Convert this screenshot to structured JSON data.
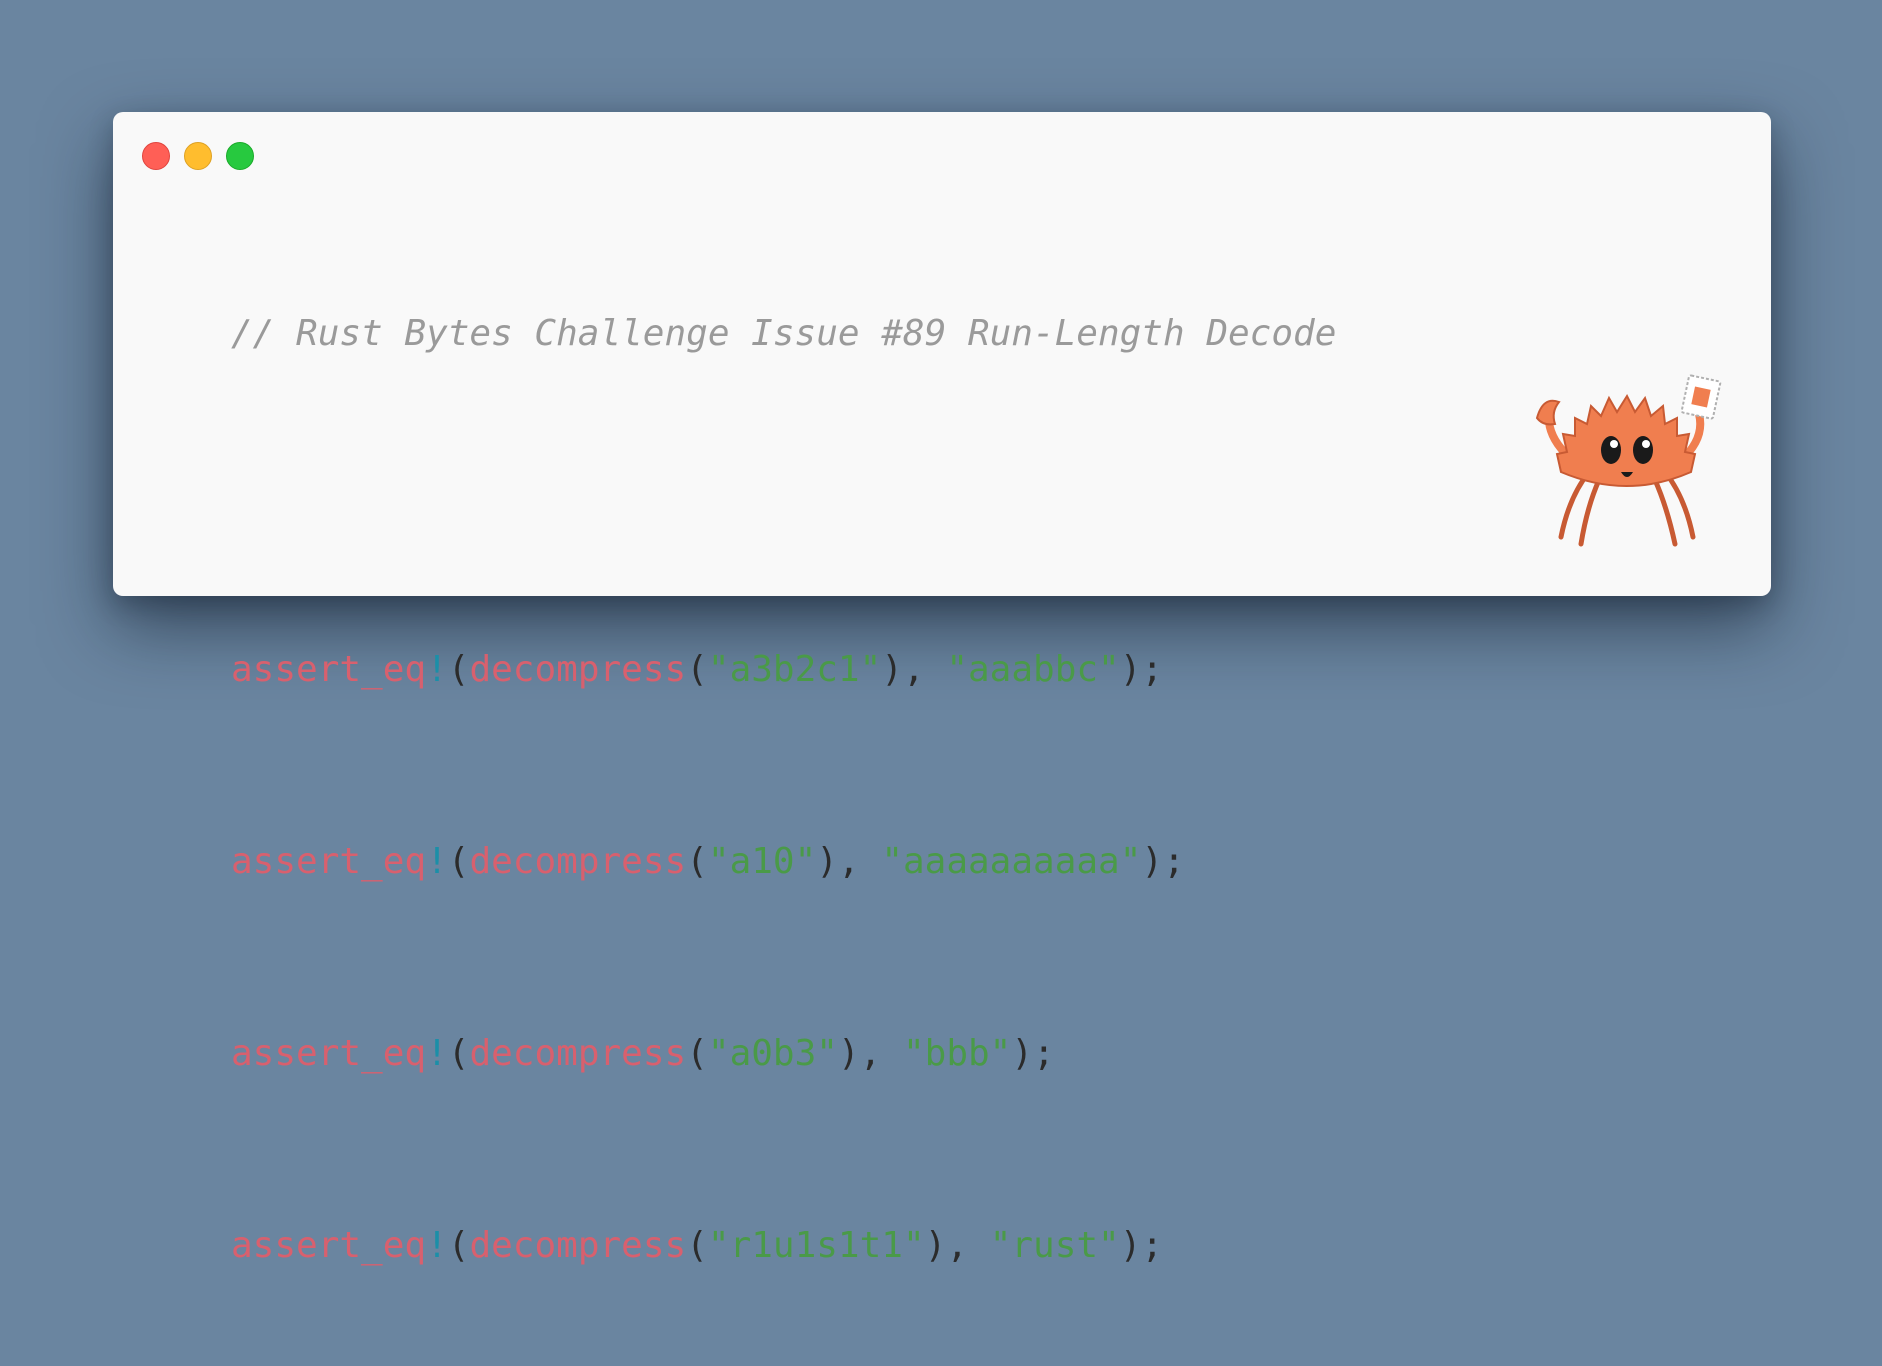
{
  "window": {
    "controls": {
      "close_color": "#ff5f56",
      "minimize_color": "#ffbd2e",
      "maximize_color": "#27c93f"
    }
  },
  "code": {
    "comment": "// Rust Bytes Challenge Issue #89 Run-Length Decode",
    "lines": [
      {
        "macro": "assert_eq",
        "bang": "!",
        "open": "(",
        "fn": "decompress",
        "fn_open": "(",
        "arg": "\"a3b2c1\"",
        "fn_close": ")",
        "sep": ", ",
        "expected": "\"aaabbc\"",
        "close": ");"
      },
      {
        "macro": "assert_eq",
        "bang": "!",
        "open": "(",
        "fn": "decompress",
        "fn_open": "(",
        "arg": "\"a10\"",
        "fn_close": ")",
        "sep": ", ",
        "expected": "\"aaaaaaaaaa\"",
        "close": ");"
      },
      {
        "macro": "assert_eq",
        "bang": "!",
        "open": "(",
        "fn": "decompress",
        "fn_open": "(",
        "arg": "\"a0b3\"",
        "fn_close": ")",
        "sep": ", ",
        "expected": "\"bbb\"",
        "close": ");"
      },
      {
        "macro": "assert_eq",
        "bang": "!",
        "open": "(",
        "fn": "decompress",
        "fn_open": "(",
        "arg": "\"r1u1s1t1\"",
        "fn_close": ")",
        "sep": ", ",
        "expected": "\"rust\"",
        "close": ");"
      }
    ]
  },
  "colors": {
    "background": "#6a85a0",
    "card": "#f9f9f9",
    "comment": "#9a9a9a",
    "macro": "#d8606e",
    "bang": "#1b8fa8",
    "string": "#4a9a48",
    "punctuation": "#2b2b2b",
    "mascot": "#f07e4f"
  },
  "mascot": {
    "icon": "ferris-crab-icon"
  }
}
